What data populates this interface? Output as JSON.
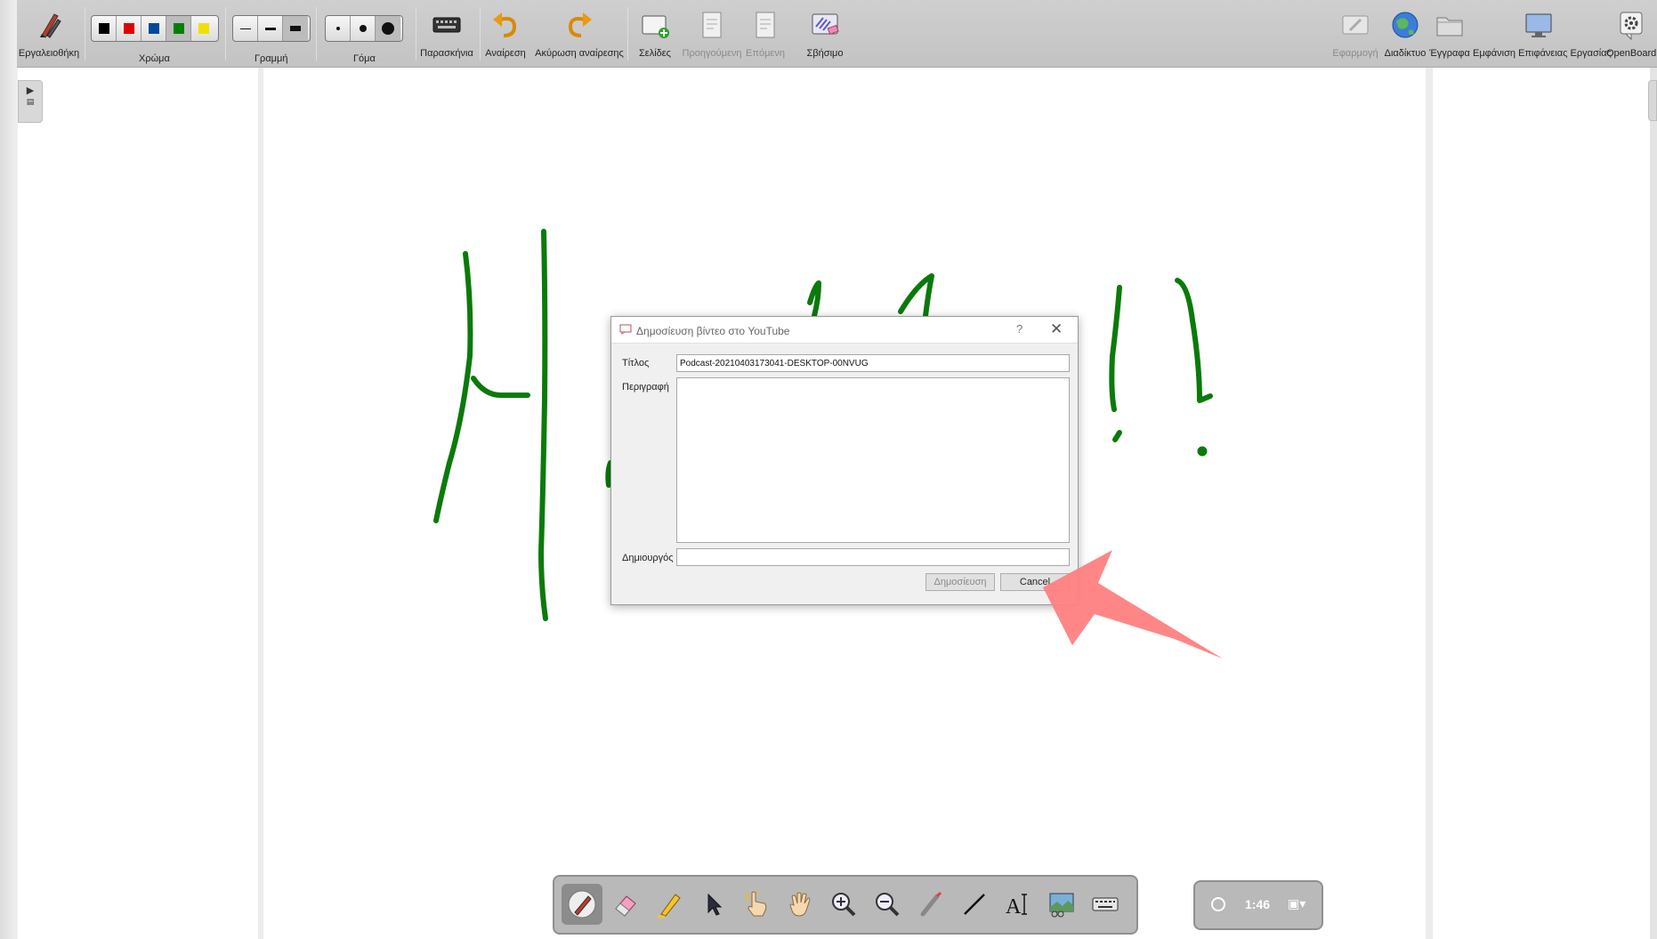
{
  "toolbar": {
    "toolbox_label": "Εργαλειοθήκη",
    "color_label": "Χρώμα",
    "line_label": "Γραμμή",
    "eraser_label": "Γόμα",
    "footnotes_label": "Παρασκήνια",
    "undo_label": "Αναίρεση",
    "redo_label": "Ακύρωση αναίρεσης",
    "pages_label": "Σελίδες",
    "previous_label": "Προηγούμενη",
    "next_label": "Επόμενη",
    "erase_label": "Σβήσιμο",
    "app_label": "Εφαρμογή",
    "web_label": "Διαδίκτυο",
    "documents_label": "Έγγραφα",
    "desktop_label": "Εμφάνιση Επιφάνειας Εργασίας",
    "openboard_label": "OpenBoard",
    "colors": [
      "#000000",
      "#e00000",
      "#004a9c",
      "#008000",
      "#f0e000"
    ],
    "selected_color": "#008000"
  },
  "dialog": {
    "title": "Δημοσίευση βίντεο στο YouTube",
    "help": "?",
    "close": "✕",
    "title_label": "Τίτλος",
    "title_value": "Podcast-20210403173041-DESKTOP-00NVUG",
    "description_label": "Περιγραφή",
    "description_value": "",
    "creator_label": "Δημιουργός",
    "creator_value": "",
    "publish_label": "Δημοσίευση",
    "cancel_label": "Cancel"
  },
  "recorder": {
    "time": "1:46",
    "menu_icon": "▣▾"
  },
  "bottom_tools": [
    "pen-tool",
    "eraser-tool",
    "marker-tool",
    "selector-tool",
    "interact-tool",
    "hand-tool",
    "zoom-in-tool",
    "zoom-out-tool",
    "laser-pointer-tool",
    "line-tool",
    "text-tool",
    "capture-tool",
    "keyboard-tool"
  ],
  "ink_color": "#0a7a0a",
  "annotation_color": "#ff7f7f"
}
